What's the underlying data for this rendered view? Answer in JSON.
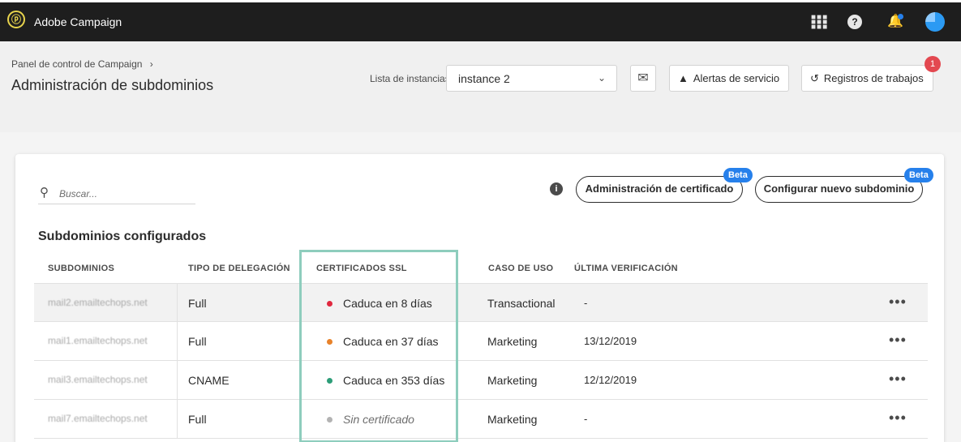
{
  "app": {
    "title": "Adobe Campaign",
    "logo": "adobe-campaign-logo"
  },
  "topbar": {
    "icons": [
      "apps-grid-icon",
      "help-icon",
      "bell-icon",
      "avatar"
    ],
    "bell_unread": true
  },
  "header": {
    "breadcrumb": "Panel de control de Campaign",
    "breadcrumb_sep": "›",
    "title": "Administración de subdominios",
    "instance_label": "Lista de instancias",
    "instance_value": "instance 2",
    "alerts_label": "Alertas de servicio",
    "logs_label": "Registros de trabajos",
    "logs_badge": "1"
  },
  "card": {
    "search_placeholder": "Buscar...",
    "cert_button": "Administración de certificado",
    "new_button": "Configurar nuevo subdominio",
    "beta": "Beta",
    "section_title": "Subdominios configurados",
    "columns": [
      "SUBDOMINIOS",
      "TIPO DE DELEGACIÓN",
      "CERTIFICADOS SSL",
      "CASO DE USO",
      "ÚLTIMA VERIFICACIÓN"
    ],
    "rows": [
      {
        "subdomain": "mail2.emailtechops.net",
        "delegation": "Full",
        "ssl": "Caduca en 8 días",
        "ssl_color": "#e0283f",
        "use": "Transactional",
        "verified": "-",
        "more": "•••"
      },
      {
        "subdomain": "mail1.emailtechops.net",
        "delegation": "Full",
        "ssl": "Caduca en 37 días",
        "ssl_color": "#e8822a",
        "use": "Marketing",
        "verified": "13/12/2019",
        "more": "•••"
      },
      {
        "subdomain": "mail3.emailtechops.net",
        "delegation": "CNAME",
        "ssl": "Caduca en 353 días",
        "ssl_color": "#2d9d78",
        "use": "Marketing",
        "verified": "12/12/2019",
        "more": "•••"
      },
      {
        "subdomain": "mail7.emailtechops.net",
        "delegation": "Full",
        "ssl": "Sin certificado",
        "ssl_color": "#b3b3b3",
        "use": "Marketing",
        "verified": "-",
        "more": "•••"
      }
    ]
  },
  "colors": {
    "topbar": "#1e1e1e",
    "accent": "#2680eb",
    "highlight": "#8ecdbd",
    "badge": "#e34850"
  }
}
